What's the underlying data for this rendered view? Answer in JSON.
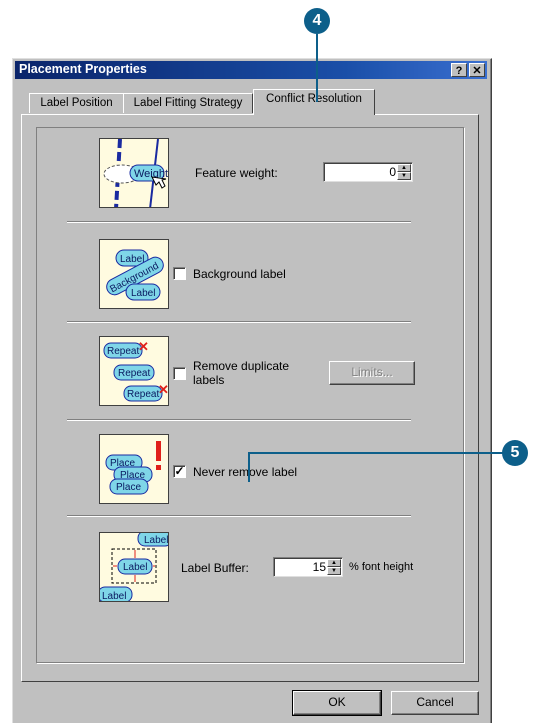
{
  "window": {
    "title": "Placement Properties",
    "help_button": "?",
    "close_button": "✕"
  },
  "tabs": [
    {
      "label": "Label Position"
    },
    {
      "label": "Label Fitting Strategy"
    },
    {
      "label": "Conflict Resolution",
      "active": true
    }
  ],
  "sections": {
    "feature_weight": {
      "label": "Feature weight:",
      "value": "0",
      "thumb_text": "Weight"
    },
    "background_label": {
      "label": "Background label",
      "checked": false,
      "thumb_texts": [
        "Label",
        "Background",
        "Label"
      ]
    },
    "remove_duplicate": {
      "label_line1": "Remove duplicate",
      "label_line2": "labels",
      "checked": false,
      "limits_button": "Limits...",
      "thumb_texts": [
        "Repeat",
        "Repeat",
        "Repeat"
      ]
    },
    "never_remove": {
      "label": "Never remove label",
      "checked": true,
      "thumb_texts": [
        "Place",
        "Place",
        "Place"
      ]
    },
    "label_buffer": {
      "label": "Label Buffer:",
      "value": "15",
      "unit": "% font height",
      "thumb_texts": [
        "Label",
        "Label",
        "Label"
      ]
    }
  },
  "buttons": {
    "ok": "OK",
    "cancel": "Cancel"
  },
  "callouts": {
    "step4": "4",
    "step5": "5"
  },
  "colors": {
    "callout": "#0d5f8a",
    "thumb_bg": "#fffbe0",
    "pill": "#7fd6e8",
    "mark_red": "#e0201a",
    "line_blue": "#1a2aa0"
  }
}
